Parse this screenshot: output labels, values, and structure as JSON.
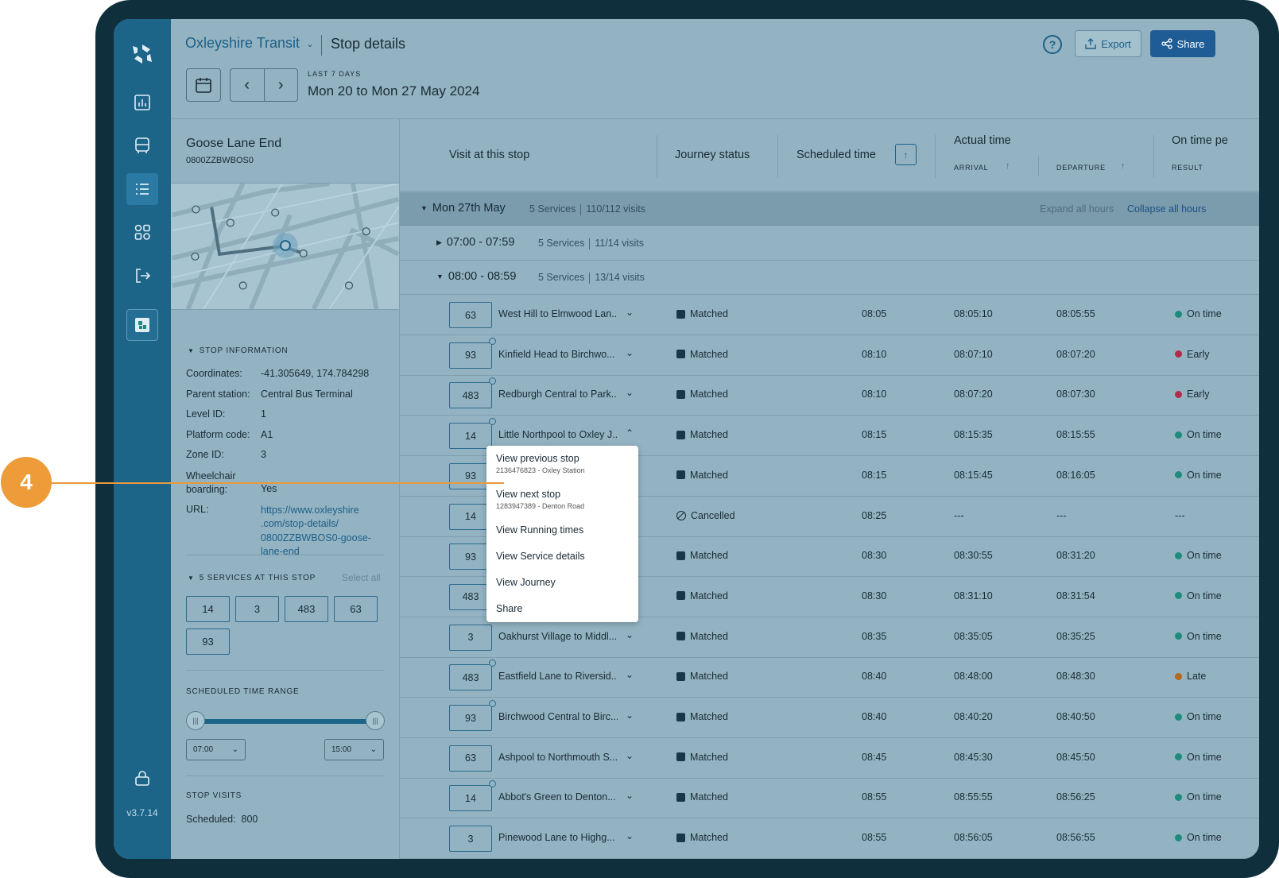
{
  "callout": {
    "number": "4"
  },
  "app": {
    "org": "Oxleyshire Transit",
    "page_title": "Stop details",
    "version": "v3.7.14"
  },
  "header": {
    "help": "?",
    "export_label": "Export",
    "share_label": "Share",
    "range_caption": "LAST 7 DAYS",
    "range_value": "Mon 20 to Mon 27 May 2024"
  },
  "nav": {
    "icons": [
      "logo-icon",
      "chart-icon",
      "bus-icon",
      "list-icon",
      "apps-icon",
      "logout-icon",
      "app-badge-icon",
      "lock-icon"
    ],
    "active": "list-icon"
  },
  "stop": {
    "name": "Goose Lane End",
    "code": "0800ZZBWBOS0"
  },
  "stop_info": {
    "heading": "STOP INFORMATION",
    "rows": [
      {
        "k": "Coordinates:",
        "v": "-41.305649, 174.784298"
      },
      {
        "k": "Parent station:",
        "v": "Central Bus Terminal"
      },
      {
        "k": "Level ID:",
        "v": "1"
      },
      {
        "k": "Platform code:",
        "v": "A1"
      },
      {
        "k": "Zone ID:",
        "v": "3"
      },
      {
        "k": "Wheelchair boarding:",
        "v": "Yes"
      }
    ],
    "url_label": "URL:",
    "url": "https://www.oxleyshire .com/stop-details/ 0800ZZBWBOS0-goose- lane-end"
  },
  "services": {
    "heading": "5 SERVICES AT THIS STOP",
    "select_all": "Select all",
    "items": [
      "14",
      "3",
      "483",
      "63",
      "93"
    ]
  },
  "time_range": {
    "heading": "SCHEDULED TIME RANGE",
    "from": "07:00",
    "to": "15:00"
  },
  "stop_visits": {
    "heading": "STOP VISITS",
    "scheduled_label": "Scheduled:",
    "scheduled_value": "800"
  },
  "table": {
    "headers": {
      "visit": "Visit at this stop",
      "status": "Journey status",
      "scheduled": "Scheduled time",
      "actual": "Actual time",
      "arrival": "ARRIVAL",
      "departure": "DEPARTURE",
      "ontime": "On time pe",
      "result": "RESULT"
    },
    "day": {
      "label": "Mon 27th May",
      "services": "5 Services",
      "visits": "110/112 visits",
      "expand_all": "Expand all hours",
      "collapse_all": "Collapse all hours"
    },
    "groups": [
      {
        "label": "07:00 - 07:59",
        "services": "5 Services",
        "visits": "11/14 visits"
      },
      {
        "label": "08:00 - 08:59",
        "services": "5 Services",
        "visits": "13/14 visits"
      }
    ],
    "rows": [
      {
        "route": "63",
        "desc": "West Hill to Elmwood Lan...",
        "status": "Matched",
        "scheduled": "08:05",
        "arrival": "08:05:10",
        "departure": "08:05:55",
        "result": "On time",
        "color": "#1f8a7e",
        "clock": false
      },
      {
        "route": "93",
        "desc": "Kinfield Head to Birchwo...",
        "status": "Matched",
        "scheduled": "08:10",
        "arrival": "08:07:10",
        "departure": "08:07:20",
        "result": "Early",
        "color": "#b42b4a",
        "clock": true
      },
      {
        "route": "483",
        "desc": "Redburgh Central to Park...",
        "status": "Matched",
        "scheduled": "08:10",
        "arrival": "08:07:20",
        "departure": "08:07:30",
        "result": "Early",
        "color": "#b42b4a",
        "clock": true
      },
      {
        "route": "14",
        "desc": "Little Northpool to Oxley J...",
        "status": "Matched",
        "scheduled": "08:15",
        "arrival": "08:15:35",
        "departure": "08:15:55",
        "result": "On time",
        "color": "#1f8a7e",
        "clock": true
      },
      {
        "route": "93",
        "desc": "",
        "status": "Matched",
        "scheduled": "08:15",
        "arrival": "08:15:45",
        "departure": "08:16:05",
        "result": "On time",
        "color": "#1f8a7e",
        "clock": false
      },
      {
        "route": "14",
        "desc": "",
        "status": "Cancelled",
        "scheduled": "08:25",
        "arrival": "---",
        "departure": "---",
        "result": "---",
        "color": "",
        "clock": false
      },
      {
        "route": "93",
        "desc": "",
        "status": "Matched",
        "scheduled": "08:30",
        "arrival": "08:30:55",
        "departure": "08:31:20",
        "result": "On time",
        "color": "#1f8a7e",
        "clock": false
      },
      {
        "route": "483",
        "desc": "",
        "status": "Matched",
        "scheduled": "08:30",
        "arrival": "08:31:10",
        "departure": "08:31:54",
        "result": "On time",
        "color": "#1f8a7e",
        "clock": false
      },
      {
        "route": "3",
        "desc": "Oakhurst Village to Middl...",
        "status": "Matched",
        "scheduled": "08:35",
        "arrival": "08:35:05",
        "departure": "08:35:25",
        "result": "On time",
        "color": "#1f8a7e",
        "clock": false
      },
      {
        "route": "483",
        "desc": "Eastfield Lane to Riversid...",
        "status": "Matched",
        "scheduled": "08:40",
        "arrival": "08:48:00",
        "departure": "08:48:30",
        "result": "Late",
        "color": "#b06a22",
        "clock": true
      },
      {
        "route": "93",
        "desc": "Birchwood Central to Birc...",
        "status": "Matched",
        "scheduled": "08:40",
        "arrival": "08:40:20",
        "departure": "08:40:50",
        "result": "On time",
        "color": "#1f8a7e",
        "clock": true
      },
      {
        "route": "63",
        "desc": "Ashpool to Northmouth S...",
        "status": "Matched",
        "scheduled": "08:45",
        "arrival": "08:45:30",
        "departure": "08:45:50",
        "result": "On time",
        "color": "#1f8a7e",
        "clock": false
      },
      {
        "route": "14",
        "desc": "Abbot's Green to Denton...",
        "status": "Matched",
        "scheduled": "08:55",
        "arrival": "08:55:55",
        "departure": "08:56:25",
        "result": "On time",
        "color": "#1f8a7e",
        "clock": true
      },
      {
        "route": "3",
        "desc": "Pinewood Lane to Highg...",
        "status": "Matched",
        "scheduled": "08:55",
        "arrival": "08:56:05",
        "departure": "08:56:55",
        "result": "On time",
        "color": "#1f8a7e",
        "clock": false
      }
    ]
  },
  "menu": {
    "items": [
      {
        "label": "View previous stop",
        "sub": "2136476823 - Oxley Station"
      },
      {
        "label": "View next stop",
        "sub": "1283947389 - Denton Road"
      },
      {
        "label": "View Running times",
        "sub": ""
      },
      {
        "label": "View Service details",
        "sub": ""
      },
      {
        "label": "View Journey",
        "sub": ""
      },
      {
        "label": "Share",
        "sub": ""
      }
    ]
  }
}
